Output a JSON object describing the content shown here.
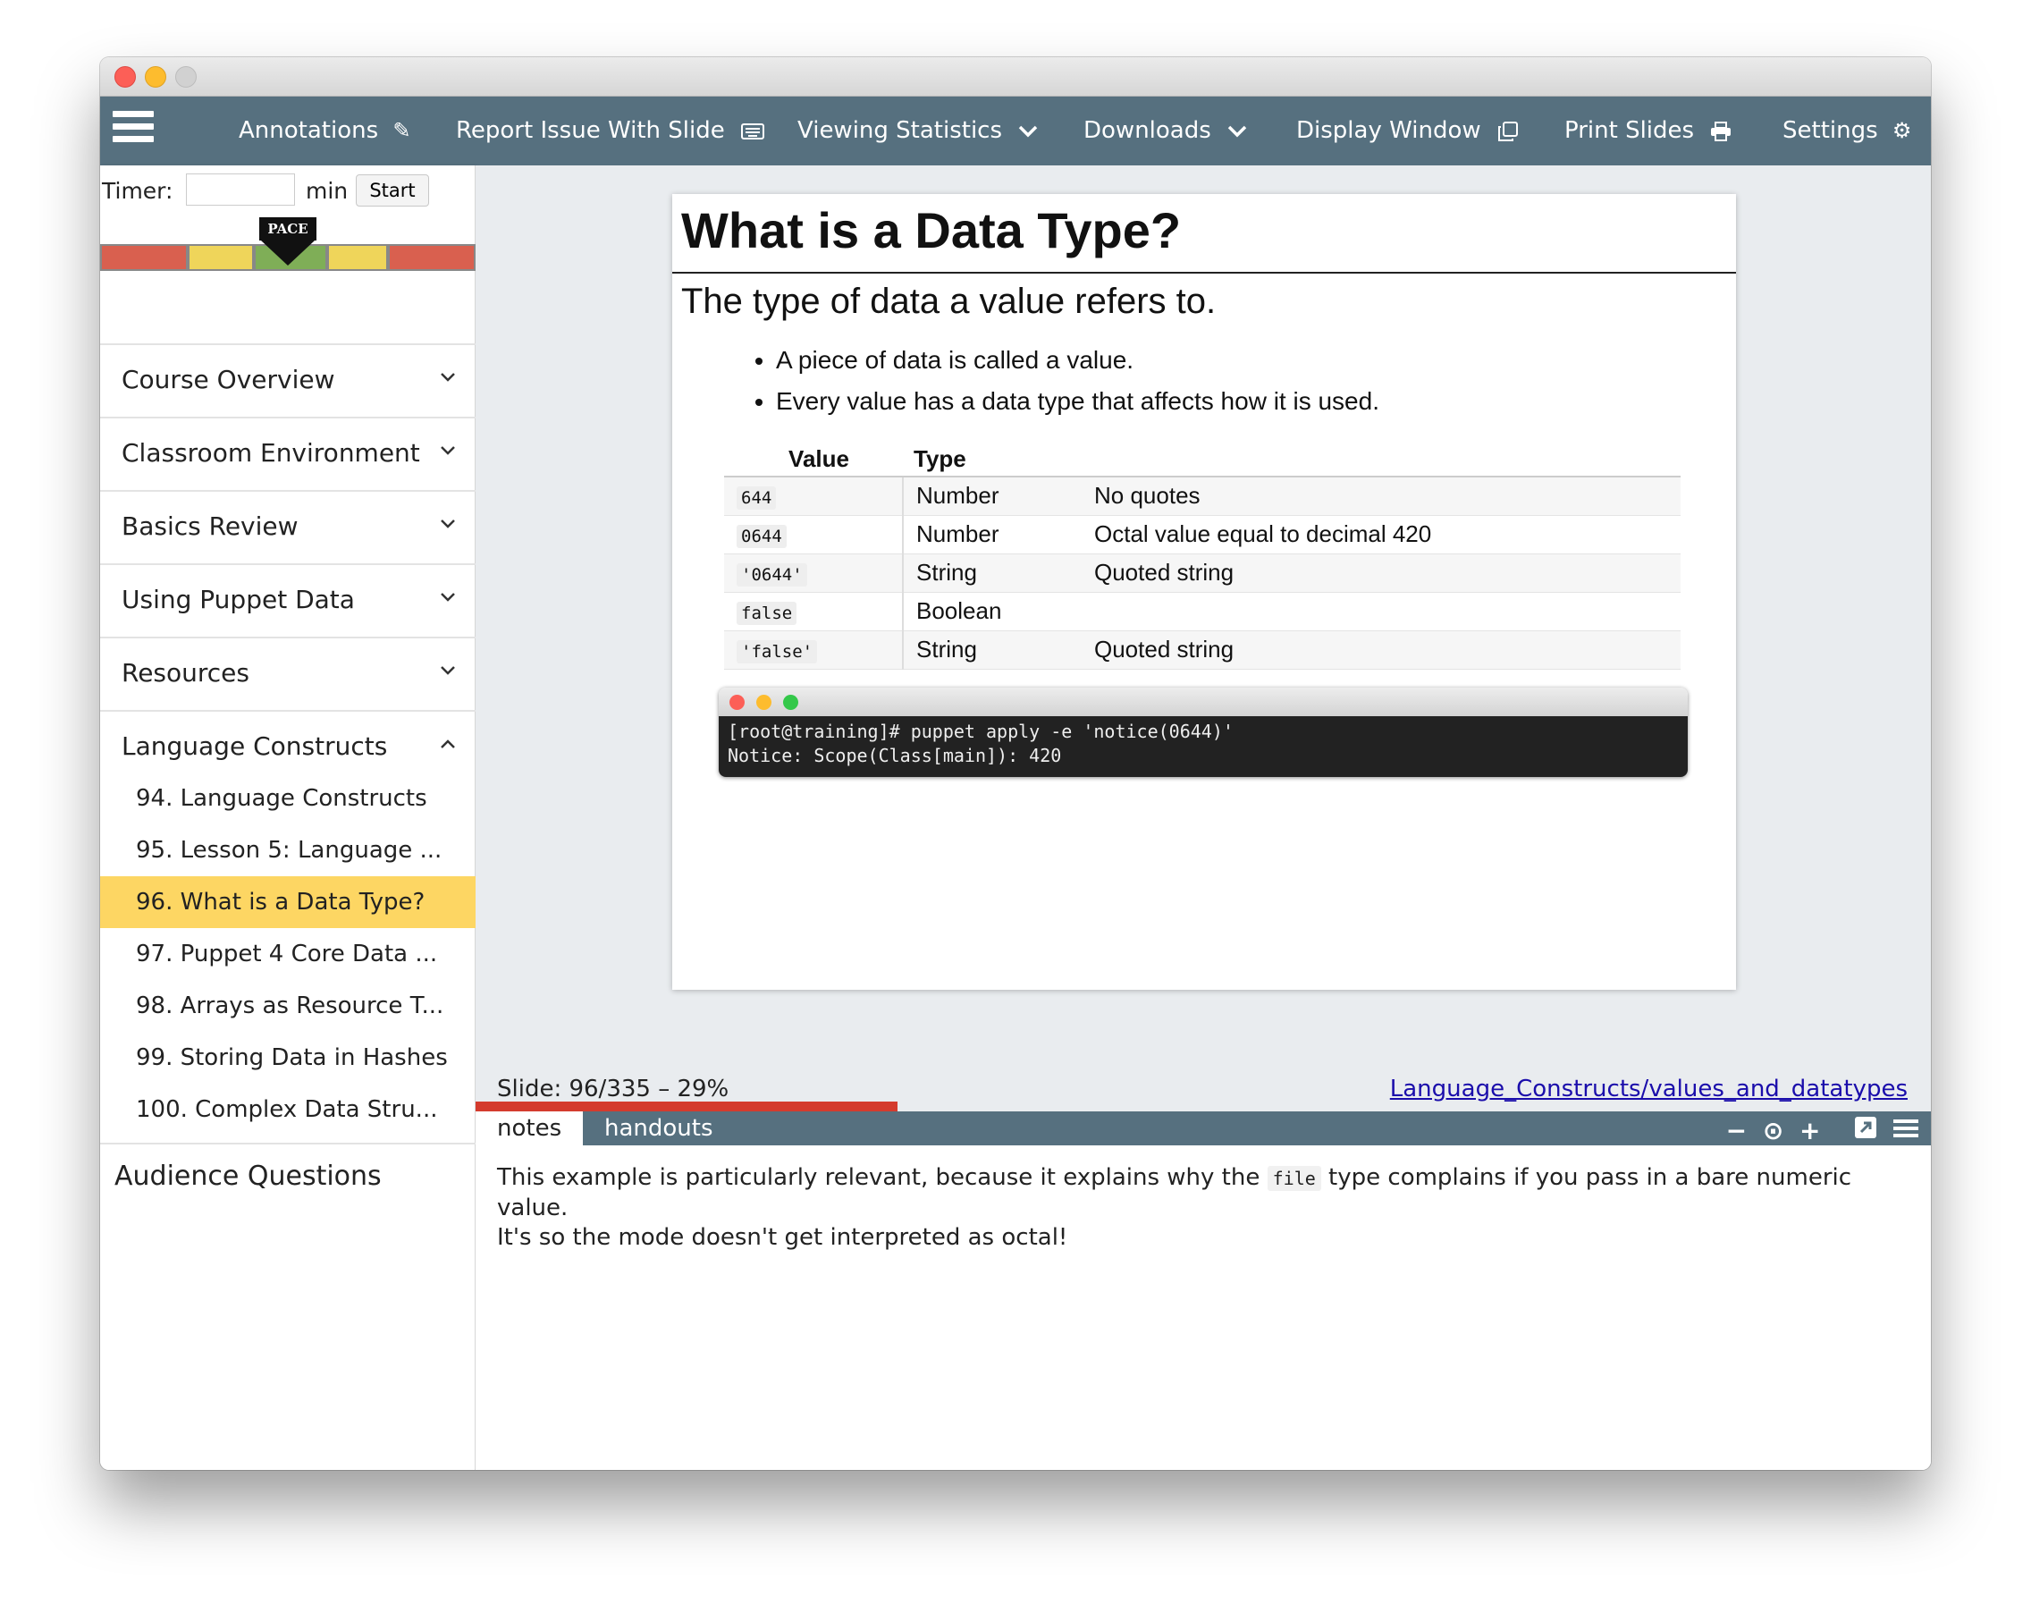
{
  "navbar": {
    "annotations": "Annotations",
    "report_issue": "Report Issue With Slide",
    "viewing_statistics": "Viewing Statistics",
    "downloads": "Downloads",
    "display_window": "Display Window",
    "print_slides": "Print Slides",
    "settings": "Settings"
  },
  "timer": {
    "label": "Timer:",
    "value": "",
    "unit": "min",
    "start_label": "Start"
  },
  "pace": {
    "label": "PACE"
  },
  "sidebar": {
    "sections": [
      "Course Overview",
      "Classroom Environment",
      "Basics Review",
      "Using Puppet Data",
      "Resources",
      "Language Constructs"
    ],
    "subitems": [
      "94. Language Constructs",
      "95. Lesson 5: Language ...",
      "96. What is a Data Type?",
      "97. Puppet 4 Core Data ...",
      "98. Arrays as Resource T...",
      "99. Storing Data in Hashes",
      "100. Complex Data Stru..."
    ],
    "active_index": 2,
    "audience_questions": "Audience Questions"
  },
  "slide": {
    "title": "What is a Data Type?",
    "subtitle": "The type of data a value refers to.",
    "bullets": [
      "A piece of data is called a value.",
      "Every value has a data type that affects how it is used."
    ],
    "table": {
      "headers": [
        "Value",
        "Type",
        ""
      ],
      "rows": [
        [
          "644",
          "Number",
          "No quotes"
        ],
        [
          "0644",
          "Number",
          "Octal value equal to decimal 420"
        ],
        [
          "'0644'",
          "String",
          "Quoted string"
        ],
        [
          "false",
          "Boolean",
          ""
        ],
        [
          "'false'",
          "String",
          "Quoted string"
        ]
      ]
    },
    "terminal": {
      "line1": "[root@training]# puppet apply -e 'notice(0644)'",
      "line2": "Notice: Scope(Class[main]): 420"
    }
  },
  "status": {
    "slide_text": "Slide: 96/335 – 29%",
    "progress_fraction": 0.29,
    "link_text": "Language_Constructs/values_and_datatypes"
  },
  "notes": {
    "tab_notes": "notes",
    "tab_handouts": "handouts",
    "text_before": "This example is particularly relevant, because it explains why the ",
    "code": "file",
    "text_after": " type complains if you pass in a bare numeric value.",
    "line2": "It's so the mode doesn't get interpreted as octal!"
  },
  "colors": {
    "navbar": "#56707f",
    "active_item": "#fdd663",
    "progress": "#d43b2e",
    "pace_red": "#d9604f",
    "pace_yellow": "#efd55a",
    "pace_green": "#7fae57"
  }
}
